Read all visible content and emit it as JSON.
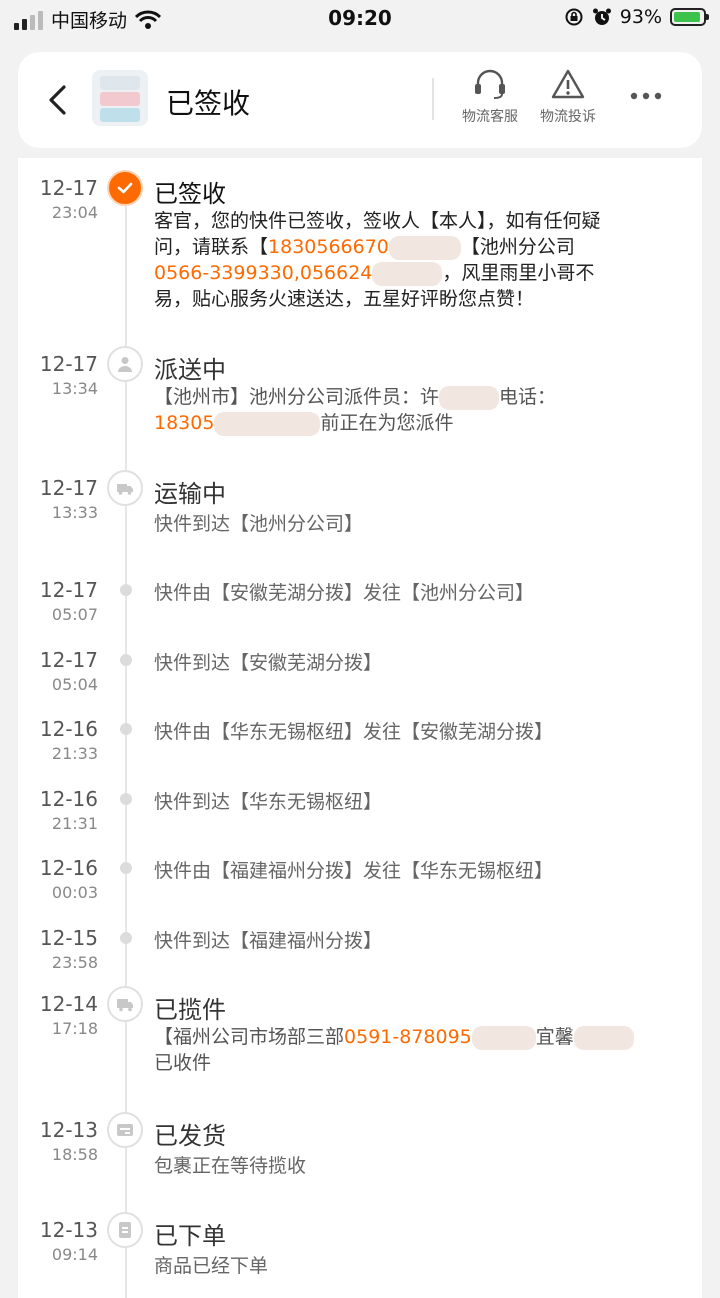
{
  "status_bar": {
    "carrier": "中国移动",
    "time": "09:20",
    "battery": "93%"
  },
  "header": {
    "title": "已签收",
    "actions": [
      {
        "label": "物流客服",
        "icon": "headset-icon"
      },
      {
        "label": "物流投诉",
        "icon": "warning-icon"
      }
    ],
    "more_icon": "more-icon"
  },
  "events": [
    {
      "date": "12-17",
      "time": "23:04",
      "title": "已签收"
    },
    {
      "date": "12-17",
      "time": "13:34",
      "title": "派送中"
    },
    {
      "date": "12-17",
      "time": "13:33",
      "title": "运输中",
      "desc": "快件到达【池州分公司】"
    },
    {
      "date": "12-17",
      "time": "05:07",
      "desc": "快件由【安徽芜湖分拨】发往【池州分公司】"
    },
    {
      "date": "12-17",
      "time": "05:04",
      "desc": "快件到达【安徽芜湖分拨】"
    },
    {
      "date": "12-16",
      "time": "21:33",
      "desc": "快件由【华东无锡枢纽】发往【安徽芜湖分拨】"
    },
    {
      "date": "12-16",
      "time": "21:31",
      "desc": "快件到达【华东无锡枢纽】"
    },
    {
      "date": "12-16",
      "time": "00:03",
      "desc": "快件由【福建福州分拨】发往【华东无锡枢纽】"
    },
    {
      "date": "12-15",
      "time": "23:58",
      "desc": "快件到达【福建福州分拨】"
    },
    {
      "date": "12-14",
      "time": "17:18",
      "title": "已揽件"
    },
    {
      "date": "12-13",
      "time": "18:58",
      "title": "已发货",
      "desc": "包裹正在等待揽收"
    },
    {
      "date": "12-13",
      "time": "09:14",
      "title": "已下单",
      "desc": "商品已经下单"
    }
  ],
  "signed": {
    "line1": "客官，您的快件已签收，签收人【本人】，如有任何疑",
    "line2_a": "问，请联系【",
    "phone1": "1830566670",
    "line2_b": "【池州分公司",
    "phone2": "0566-3399330,056624",
    "line3_b": "，风里雨里小哥不",
    "line4": "易，贴心服务火速送达，五星好评盼您点赞！"
  },
  "dispatch": {
    "line1_a": "【池州市】池州分公司派件员：许",
    "line1_b": "电话：",
    "phone": "18305",
    "line2_b": "前正在为您派件"
  },
  "pickup": {
    "line1_a": "【福州公司市场部三部",
    "phone": "0591-878095",
    "line1_b": "宜馨",
    "line2": "已收件"
  }
}
